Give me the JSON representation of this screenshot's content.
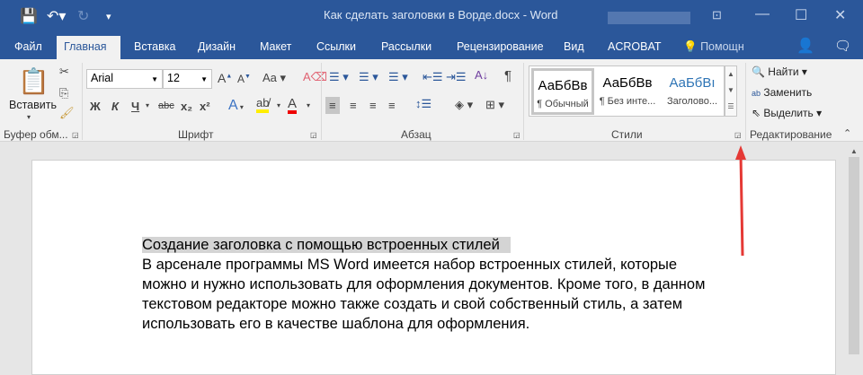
{
  "window": {
    "title": "Как сделать заголовки в Ворде.docx - Word"
  },
  "tabs": [
    "Файл",
    "Главная",
    "Вставка",
    "Дизайн",
    "Макет",
    "Ссылки",
    "Рассылки",
    "Рецензирование",
    "Вид",
    "ACROBAT",
    "Помощн"
  ],
  "ribbon": {
    "clipboard": {
      "paste": "Вставить",
      "label": "Буфер обм..."
    },
    "font": {
      "name": "Arial",
      "size": "12",
      "label": "Шрифт",
      "bold": "Ж",
      "italic": "К",
      "underline": "Ч",
      "strike": "abc",
      "sub": "x₂",
      "sup": "x²",
      "case": "Aa"
    },
    "paragraph": {
      "label": "Абзац"
    },
    "styles": {
      "label": "Стили",
      "items": [
        {
          "sample": "АаБбВв",
          "name": "¶ Обычный"
        },
        {
          "sample": "АаБбВв",
          "name": "¶ Без инте..."
        },
        {
          "sample": "АаБбВı",
          "name": "Заголово..."
        }
      ]
    },
    "editing": {
      "label": "Редактирование",
      "find": "Найти",
      "replace": "Заменить",
      "select": "Выделить"
    }
  },
  "document": {
    "heading": "Создание заголовка с помощью встроенных стилей",
    "lines": [
      "В арсенале программы MS Word имеется набор встроенных стилей, которые",
      "можно и нужно использовать для оформления документов. Кроме того, в данном",
      "текстовом редакторе можно также создать и свой собственный стиль, а затем",
      "использовать его в качестве шаблона для оформления."
    ]
  },
  "colors": {
    "brand": "#2b579a",
    "arrow": "#e53935"
  }
}
